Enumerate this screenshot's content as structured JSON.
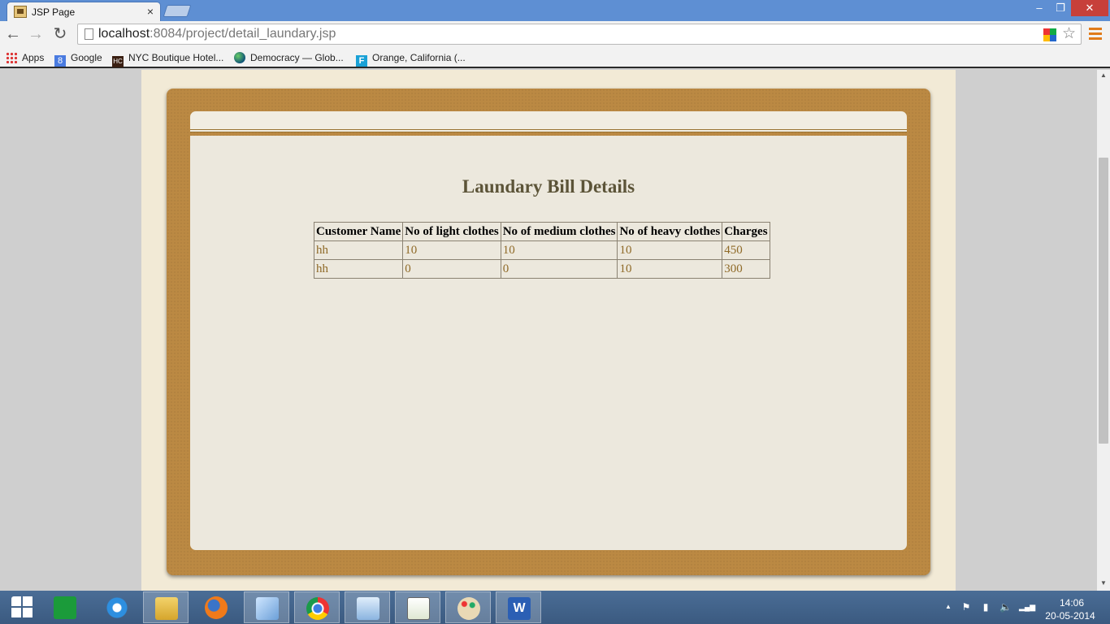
{
  "browser": {
    "tab_title": "JSP Page",
    "tab_close": "×",
    "window_minimize": "–",
    "window_maximize": "❐",
    "window_close": "✕",
    "url_host": "localhost",
    "url_rest": ":8084/project/detail_laundary.jsp",
    "back_glyph": "←",
    "forward_glyph": "→",
    "reload_glyph": "↻",
    "star_glyph": "☆",
    "bookmarks": [
      {
        "label": "Apps",
        "icon": "apps-grid-icon"
      },
      {
        "label": "Google",
        "icon": "google-icon",
        "icon_text": "8"
      },
      {
        "label": "NYC Boutique Hotel...",
        "icon": "hc-icon",
        "icon_text": "HC"
      },
      {
        "label": "Democracy — Glob...",
        "icon": "globe-icon"
      },
      {
        "label": "Orange, California (...",
        "icon": "orange-f-icon",
        "icon_text": "F"
      }
    ]
  },
  "page": {
    "title": "Laundary Bill Details",
    "table": {
      "headers": [
        "Customer Name",
        "No of light clothes",
        "No of medium clothes",
        "No of heavy clothes",
        "Charges"
      ],
      "rows": [
        [
          "hh",
          "10",
          "10",
          "10",
          "450"
        ],
        [
          "hh",
          "0",
          "0",
          "10",
          "300"
        ]
      ]
    }
  },
  "taskbar": {
    "word_glyph": "W",
    "tray_up": "▲",
    "tray_flag": "⚑",
    "tray_power": "▮",
    "tray_volume": "🔈",
    "tray_network": "▂▄▆",
    "time": "14:06",
    "date": "20-05-2014"
  },
  "colors": {
    "frame": "#bb8943",
    "panel": "#ece8dd",
    "title_text": "#5c5438",
    "cell_text": "#8f6a28",
    "page_bg": "#f2ead6"
  }
}
